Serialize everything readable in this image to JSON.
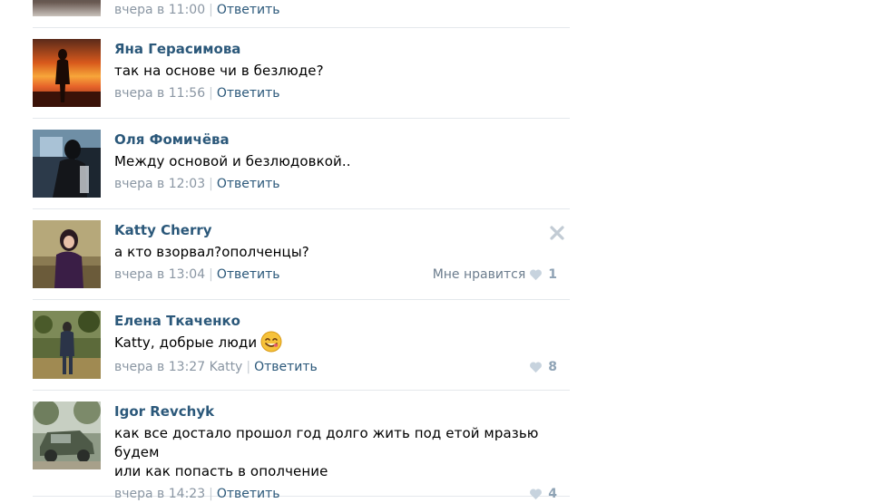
{
  "top_comment": {
    "time": "вчера в 11:00",
    "reply_label": "Ответить"
  },
  "comments": [
    {
      "author": "Яна Герасимова",
      "text": "так на основе чи в безлюде?",
      "time": "вчера в 11:56",
      "reply_label": "Ответить"
    },
    {
      "author": "Оля Фомичёва",
      "text": "Между основой и безлюдовкой..",
      "time": "вчера в 12:03",
      "reply_label": "Ответить"
    },
    {
      "author": "Katty Cherry",
      "text": "а кто взорвал?ополченцы?",
      "time": "вчера в 13:04",
      "reply_label": "Ответить",
      "like_label": "Мне нравится",
      "likes": "1"
    },
    {
      "author": "Елена Ткаченко",
      "text": "Katty, добрые люди",
      "time": "вчера в 13:27",
      "reply_to": "Katty",
      "reply_label": "Ответить",
      "likes": "8"
    },
    {
      "author": "Igor Revchyk",
      "text_line1": "как все достало прошол год долго жить под етой мразью будем",
      "text_line2": "или как попасть в ополчение",
      "time": "вчера в 14:23",
      "reply_label": "Ответить",
      "likes": "4"
    }
  ],
  "icons": {
    "heart": "heart-icon",
    "close": "close-icon",
    "smiley": "smiley-icon"
  },
  "colors": {
    "author": "#2b587a",
    "meta": "#8a96a3",
    "divider": "#e4e8ec",
    "heart": "#c7d3de"
  }
}
